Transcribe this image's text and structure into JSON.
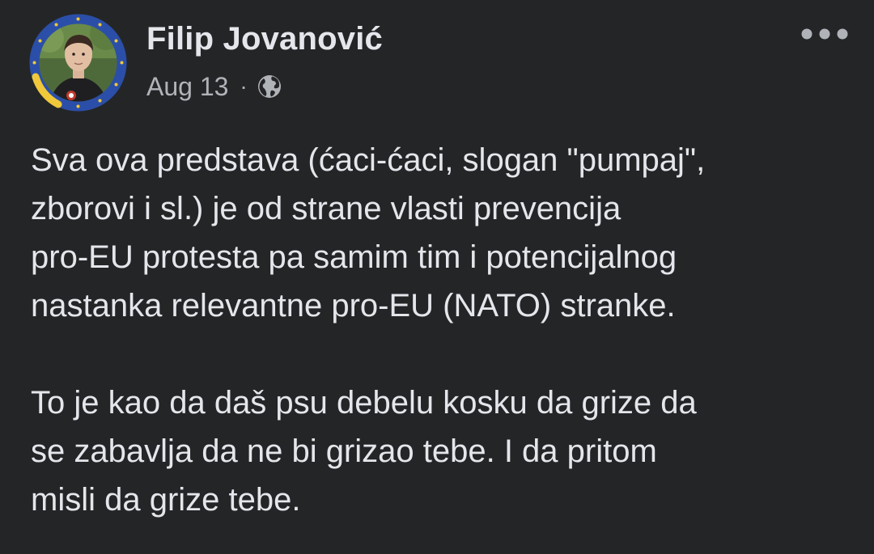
{
  "post": {
    "author": {
      "name": "Filip Jovanović",
      "avatar_icon": "profile-photo-with-eu-frame",
      "frame_colors": {
        "ring": "#2b4fa8",
        "stars": "#f1c83a",
        "accent": "#f1c83a"
      }
    },
    "meta": {
      "date": "Aug 13",
      "separator": "·",
      "audience_icon": "globe-icon"
    },
    "menu_icon": "more-options-icon",
    "body": {
      "paragraph1": {
        "line1": "Sva ova predstava (ćaci-ćaci, slogan \"pumpaj\",",
        "line2": "zborovi i sl.) je od strane vlasti prevencija",
        "line3": "pro-EU protesta pa samim tim i potencijalnog",
        "line4": "nastanka relevantne pro-EU (NATO) stranke."
      },
      "paragraph2": {
        "line1": "To je kao da daš psu debelu kosku da grize da",
        "line2": "se zabavlja da ne bi grizao tebe. I da pritom",
        "line3": "misli da grize tebe."
      }
    },
    "colors": {
      "background": "#242526",
      "primary_text": "#e4e6eb",
      "secondary_text": "#b0b3b8"
    }
  }
}
